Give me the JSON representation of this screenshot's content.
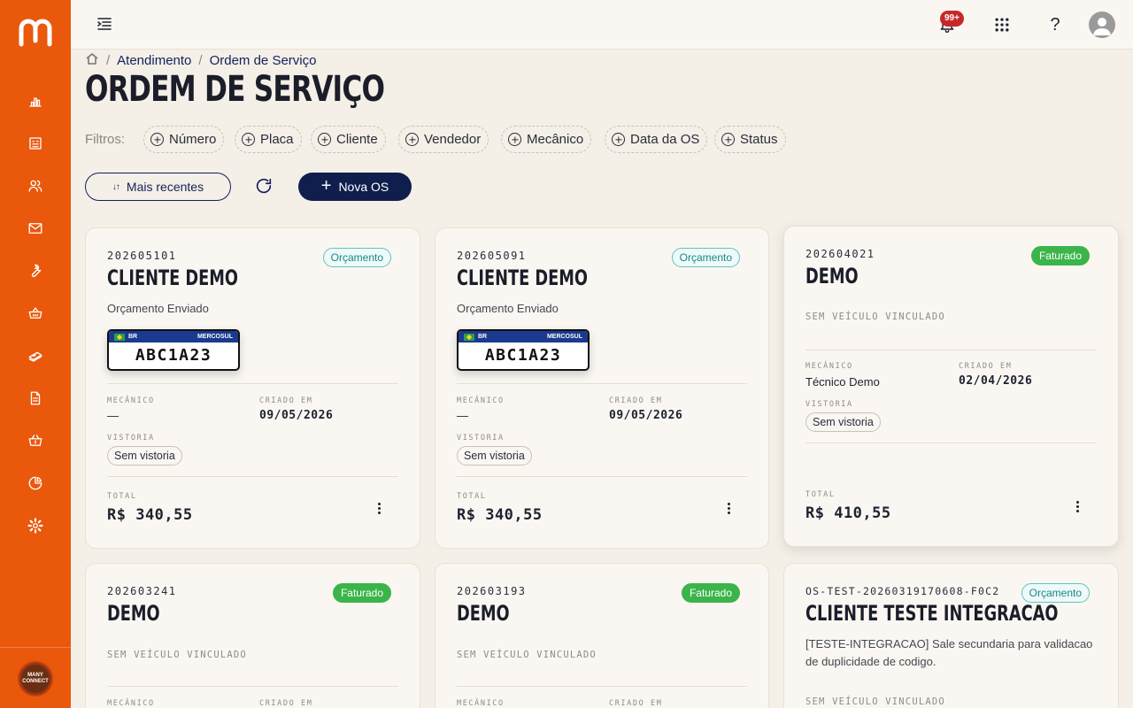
{
  "app": {
    "logo_letter": "m",
    "org_avatar_text": "MANY CONNECT"
  },
  "sidebar": {
    "items": [
      {
        "id": "dashboard",
        "icon": "bar-chart-icon"
      },
      {
        "id": "pos",
        "icon": "cash-register-icon"
      },
      {
        "id": "customers",
        "icon": "users-icon"
      },
      {
        "id": "messages",
        "icon": "mail-icon"
      },
      {
        "id": "service",
        "icon": "wrench-icon"
      },
      {
        "id": "sales",
        "icon": "basket-icon"
      },
      {
        "id": "finance",
        "icon": "money-icon"
      },
      {
        "id": "documents",
        "icon": "document-icon"
      },
      {
        "id": "purchases",
        "icon": "shopping-basket-icon"
      },
      {
        "id": "reports",
        "icon": "pie-chart-icon"
      },
      {
        "id": "settings",
        "icon": "gear-icon"
      }
    ]
  },
  "topbar": {
    "notifications_badge": "99+",
    "help_label": "?"
  },
  "breadcrumb": {
    "section": "Atendimento",
    "current": "Ordem de Serviço"
  },
  "page": {
    "title": "ORDEM DE SERVIÇO"
  },
  "filters": {
    "label": "Filtros:",
    "chips": [
      "Número",
      "Placa",
      "Cliente",
      "Vendedor",
      "Mecânico",
      "Data da OS",
      "Status"
    ]
  },
  "actions": {
    "sort_label": "Mais recentes",
    "new_label": "Nova OS"
  },
  "labels": {
    "mechanic": "MECÂNICO",
    "created": "CRIADO EM",
    "inspection": "VISTORIA",
    "total": "TOTAL"
  },
  "colors": {
    "brand": "#ea580c",
    "navy": "#0f1e4d",
    "status_budget": "#128a8a",
    "status_billed": "#3bb54a"
  },
  "cards": [
    {
      "number": "202605101",
      "status": "Orçamento",
      "client": "CLIENTE DEMO",
      "description": "Orçamento Enviado",
      "plate": {
        "country": "BR",
        "region": "MERCOSUL",
        "number": "ABC1A23"
      },
      "mechanic": "—",
      "created": "09/05/2026",
      "inspection": "Sem vistoria",
      "total": "R$ 340,55"
    },
    {
      "number": "202605091",
      "status": "Orçamento",
      "client": "CLIENTE DEMO",
      "description": "Orçamento Enviado",
      "plate": {
        "country": "BR",
        "region": "MERCOSUL",
        "number": "ABC1A23"
      },
      "mechanic": "—",
      "created": "09/05/2026",
      "inspection": "Sem vistoria",
      "total": "R$ 340,55"
    },
    {
      "number": "202604021",
      "status": "Faturado",
      "client": "DEMO",
      "no_vehicle": "SEM VEÍCULO VINCULADO",
      "mechanic": "Técnico Demo",
      "created": "02/04/2026",
      "inspection": "Sem vistoria",
      "total": "R$ 410,55"
    },
    {
      "number": "202603241",
      "status": "Faturado",
      "client": "DEMO",
      "no_vehicle": "SEM VEÍCULO VINCULADO"
    },
    {
      "number": "202603193",
      "status": "Faturado",
      "client": "DEMO",
      "no_vehicle": "SEM VEÍCULO VINCULADO"
    },
    {
      "number": "OS-TEST-20260319170608-F0C2",
      "status": "Orçamento",
      "client": "CLIENTE TESTE INTEGRACAO",
      "description": "[TESTE-INTEGRACAO] Sale secundaria para validacao de duplicidade de codigo.",
      "no_vehicle": "SEM VEÍCULO VINCULADO"
    }
  ]
}
